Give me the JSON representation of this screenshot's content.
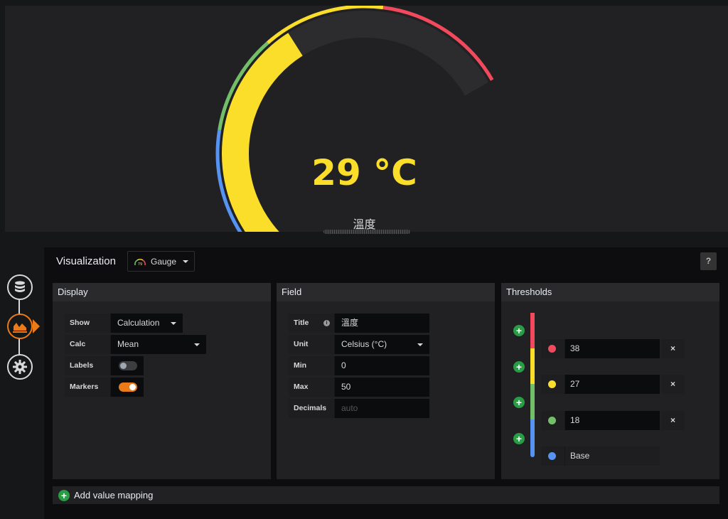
{
  "gauge": {
    "value_text": "29 °C",
    "title": "溫度",
    "value": 29,
    "min": 0,
    "max": 50,
    "value_color": "#fade2a",
    "track_color": "#2c2c2e",
    "thresholds": [
      {
        "from": 0,
        "color": "#5794f2"
      },
      {
        "from": 18,
        "color": "#73bf69"
      },
      {
        "from": 27,
        "color": "#fade2a"
      },
      {
        "from": 38,
        "color": "#f2495c"
      }
    ]
  },
  "sidebar": {
    "items": [
      {
        "icon": "database-icon"
      },
      {
        "icon": "visualization-icon",
        "active": true
      },
      {
        "icon": "gear-icon"
      }
    ]
  },
  "visualization": {
    "label": "Visualization",
    "selected": "Gauge",
    "help": "?"
  },
  "display": {
    "title": "Display",
    "show_label": "Show",
    "show_value": "Calculation",
    "calc_label": "Calc",
    "calc_value": "Mean",
    "labels_label": "Labels",
    "labels_on": false,
    "markers_label": "Markers",
    "markers_on": true
  },
  "field": {
    "title": "Field",
    "title_label": "Title",
    "title_value": "溫度",
    "unit_label": "Unit",
    "unit_value": "Celsius (°C)",
    "min_label": "Min",
    "min_value": "0",
    "max_label": "Max",
    "max_value": "50",
    "decimals_label": "Decimals",
    "decimals_placeholder": "auto"
  },
  "thresholds": {
    "title": "Thresholds",
    "items": [
      {
        "value": "38",
        "color": "#f2495c"
      },
      {
        "value": "27",
        "color": "#fade2a"
      },
      {
        "value": "18",
        "color": "#73bf69"
      },
      {
        "value": "Base",
        "color": "#5794f2"
      }
    ],
    "delete_glyph": "×"
  },
  "mapping": {
    "label": "Add value mapping"
  }
}
